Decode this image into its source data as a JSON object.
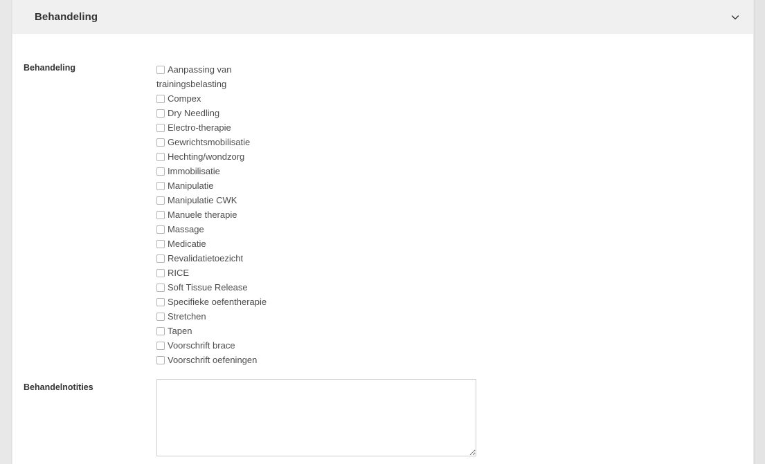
{
  "panel": {
    "title": "Behandeling",
    "collapse_icon": "chevron-down-icon",
    "header_bg": "#f0f0f0",
    "body_bg": "#ffffff"
  },
  "form": {
    "rows": [
      {
        "label": "Behandeling",
        "type": "checkbox-group",
        "options": [
          {
            "label": "Aanpassing van trainingsbelasting",
            "checked": false
          },
          {
            "label": "Compex",
            "checked": false
          },
          {
            "label": "Dry Needling",
            "checked": false
          },
          {
            "label": "Electro-therapie",
            "checked": false
          },
          {
            "label": "Gewrichtsmobilisatie",
            "checked": false
          },
          {
            "label": "Hechting/wondzorg",
            "checked": false
          },
          {
            "label": "Immobilisatie",
            "checked": false
          },
          {
            "label": "Manipulatie",
            "checked": false
          },
          {
            "label": "Manipulatie CWK",
            "checked": false
          },
          {
            "label": "Manuele therapie",
            "checked": false
          },
          {
            "label": "Massage",
            "checked": false
          },
          {
            "label": "Medicatie",
            "checked": false
          },
          {
            "label": "Revalidatietoezicht",
            "checked": false
          },
          {
            "label": "RICE",
            "checked": false
          },
          {
            "label": "Soft Tissue Release",
            "checked": false
          },
          {
            "label": "Specifieke oefentherapie",
            "checked": false
          },
          {
            "label": "Stretchen",
            "checked": false
          },
          {
            "label": "Tapen",
            "checked": false
          },
          {
            "label": "Voorschrift brace",
            "checked": false
          },
          {
            "label": "Voorschrift oefeningen",
            "checked": false
          }
        ]
      },
      {
        "label": "Behandelnotities",
        "type": "textarea",
        "value": "",
        "placeholder": ""
      }
    ]
  },
  "colors": {
    "label_text": "#333333",
    "option_text": "#4c4c4c",
    "border": "#cccccc",
    "page_bg": "#e9e9e9"
  }
}
